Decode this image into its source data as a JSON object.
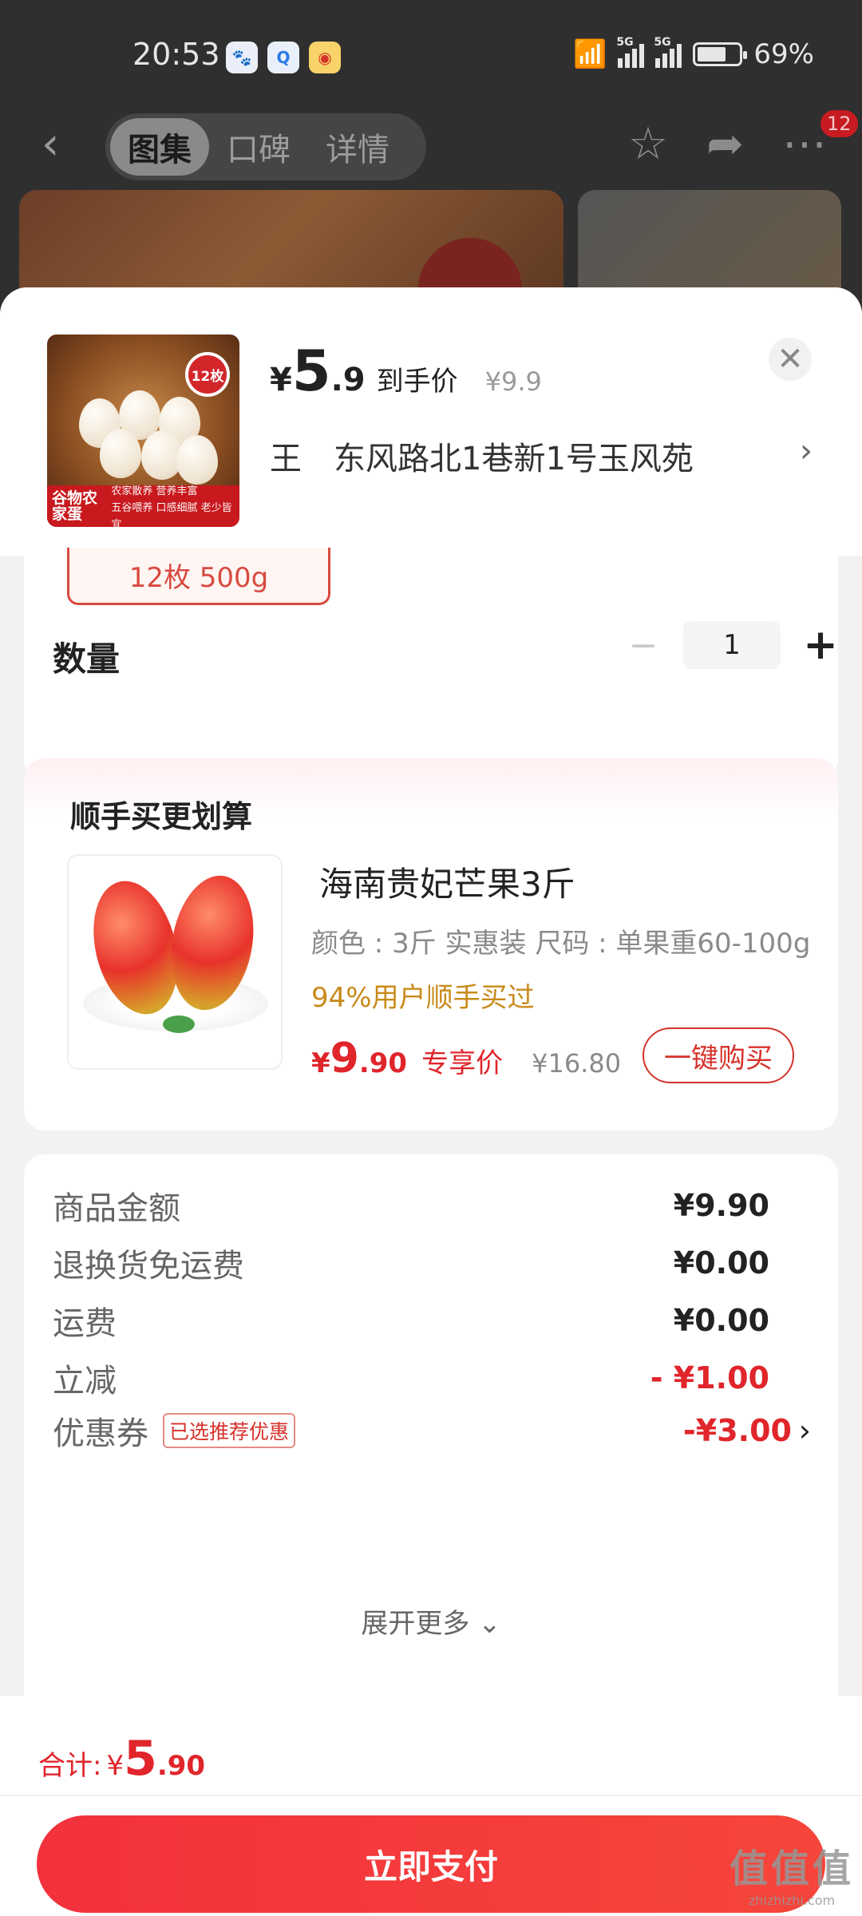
{
  "status_bar": {
    "time": "20:53",
    "battery": "69%",
    "signal_label_1": "5G",
    "signal_label_2": "5G"
  },
  "nav": {
    "tabs": [
      "图集",
      "口碑",
      "详情"
    ],
    "active_tab": 0,
    "notification_count": "12"
  },
  "product": {
    "price_symbol": "¥",
    "price_int": "5",
    "price_dec": ".9",
    "price_tag": "到手价",
    "original_price": "¥9.9",
    "thumb_badge": "12枚",
    "thumb_brand": "谷物农家蛋",
    "thumb_caption_1": "农家散养 营养丰富",
    "thumb_caption_2": "五谷喂养 口感细腻 老少皆宜"
  },
  "address": {
    "name": "王",
    "text": "东风路北1巷新1号玉风苑"
  },
  "sku": {
    "selected": "12枚 500g"
  },
  "quantity": {
    "label": "数量",
    "value": "1",
    "minus": "−",
    "plus": "+"
  },
  "recommend": {
    "title": "顺手买更划算",
    "name": "海南贵妃芒果3斤",
    "spec": "颜色 : 3斤 实惠装   尺码 : 单果重60-100g",
    "social": "94%用户顺手买过",
    "price_symbol": "¥",
    "price_int": "9",
    "price_dec": ".90",
    "price_tag": "专享价",
    "original_price": "¥16.80",
    "buy_button": "一键购买"
  },
  "fees": {
    "items": [
      {
        "label": "商品金额",
        "value": "¥9.90"
      },
      {
        "label": "退换货免运费",
        "value": "¥0.00"
      },
      {
        "label": "运费",
        "value": "¥0.00"
      },
      {
        "label": "立减",
        "value": "- ¥1.00"
      },
      {
        "label": "优惠券",
        "value": "-¥3.00",
        "tag": "已选推荐优惠"
      }
    ],
    "expand": "展开更多 ⌄"
  },
  "footer": {
    "total_label": "合计:",
    "total_symbol": "¥",
    "total_int": "5",
    "total_dec": ".90",
    "pay_button": "立即支付"
  },
  "watermark": {
    "big": "值值值",
    "small": "zhizhizhi.com"
  },
  "colors": {
    "accent_red": "#e0252b",
    "pay_button": "#f2313c",
    "social_gold": "#c98a1a"
  }
}
